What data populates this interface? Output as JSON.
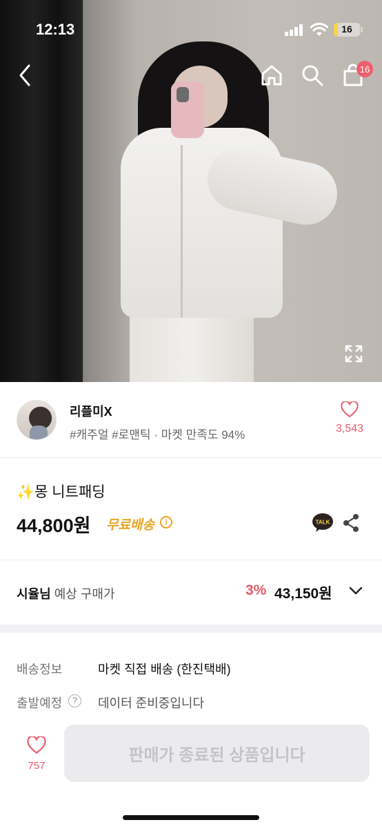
{
  "status_bar": {
    "time": "12:13",
    "battery_level": "16",
    "battery_color": "#f5d547"
  },
  "nav": {
    "back_icon": "chevron-left-icon",
    "home_icon": "home-icon",
    "search_icon": "search-icon",
    "cart_icon": "shopping-bag-icon",
    "cart_badge": "16"
  },
  "seller": {
    "name": "리플미X",
    "meta": "#캐주얼 #로맨틱 · 마켓 만족도 94%",
    "likes": "3,543"
  },
  "product": {
    "sparkle": "✨",
    "title": "몽 니트패딩",
    "price": "44,800원",
    "shipping_badge": "무료배송",
    "talk_label": "TALK"
  },
  "expected_price": {
    "user_name": "시율님",
    "label": "예상 구매가",
    "discount_rate": "3%",
    "price": "43,150원"
  },
  "delivery": {
    "shipping_label": "배송정보",
    "shipping_value": "마켓 직접 배송 (한진택배)",
    "departure_label": "출발예정",
    "departure_value": "데이터 준비중입니다"
  },
  "bottom_bar": {
    "wish_count": "757",
    "buy_button_label": "판매가 종료된 상품입니다"
  },
  "colors": {
    "accent_pink": "#e85a6b",
    "free_shipping": "#e9a423",
    "badge": "#ee5f6d"
  }
}
